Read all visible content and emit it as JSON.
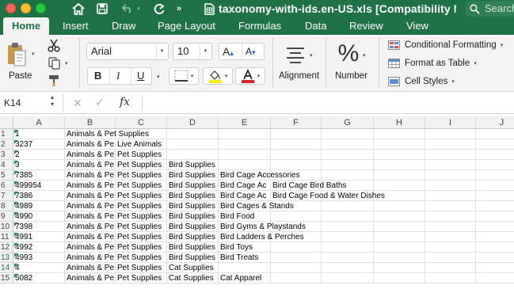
{
  "window": {
    "title": "taxonomy-with-ids.en-US.xls  [Compatibility Mode]",
    "search_placeholder": "Search"
  },
  "tabs": [
    "Home",
    "Insert",
    "Draw",
    "Page Layout",
    "Formulas",
    "Data",
    "Review",
    "View"
  ],
  "ribbon": {
    "paste_label": "Paste",
    "font_name": "Arial",
    "font_size": "10",
    "bold": "B",
    "italic": "I",
    "underline": "U",
    "alignment_label": "Alignment",
    "number_label": "Number",
    "conditional_formatting": "Conditional Formatting",
    "format_as_table": "Format as Table",
    "cell_styles": "Cell Styles",
    "highlight_color": "#ffee00",
    "font_color": "#e02020"
  },
  "formula_bar": {
    "name_box": "K14",
    "fx_label": "fx",
    "formula": ""
  },
  "sheet": {
    "columns": [
      "A",
      "B",
      "C",
      "D",
      "E",
      "F",
      "G",
      "H",
      "I",
      "J"
    ],
    "highlighted_rows": [
      "13",
      "14"
    ],
    "rows": [
      {
        "num": "1",
        "cells": [
          "1",
          "Animals & Pet Supplies",
          "",
          "",
          "",
          ""
        ]
      },
      {
        "num": "2",
        "cells": [
          "3237",
          "Animals & Pe",
          "Live Animals",
          "",
          "",
          ""
        ]
      },
      {
        "num": "3",
        "cells": [
          "2",
          "Animals & Pe",
          "Pet Supplies",
          "",
          "",
          ""
        ]
      },
      {
        "num": "4",
        "cells": [
          "3",
          "Animals & Pe",
          "Pet Supplies",
          "Bird Supplies",
          "",
          ""
        ]
      },
      {
        "num": "5",
        "cells": [
          "7385",
          "Animals & Pe",
          "Pet Supplies",
          "Bird Supplies",
          "Bird Cage Accessories",
          ""
        ]
      },
      {
        "num": "6",
        "cells": [
          "499954",
          "Animals & Pe",
          "Pet Supplies",
          "Bird Supplies",
          "Bird Cage Ac",
          "Bird Cage Bird Baths"
        ]
      },
      {
        "num": "7",
        "cells": [
          "7386",
          "Animals & Pe",
          "Pet Supplies",
          "Bird Supplies",
          "Bird Cage Ac",
          "Bird Cage Food & Water Dishes"
        ]
      },
      {
        "num": "8",
        "cells": [
          "4989",
          "Animals & Pe",
          "Pet Supplies",
          "Bird Supplies",
          "Bird Cages & Stands",
          ""
        ]
      },
      {
        "num": "9",
        "cells": [
          "4990",
          "Animals & Pe",
          "Pet Supplies",
          "Bird Supplies",
          "Bird Food",
          ""
        ]
      },
      {
        "num": "10",
        "cells": [
          "7398",
          "Animals & Pe",
          "Pet Supplies",
          "Bird Supplies",
          "Bird Gyms & Playstands",
          ""
        ]
      },
      {
        "num": "11",
        "cells": [
          "4991",
          "Animals & Pe",
          "Pet Supplies",
          "Bird Supplies",
          "Bird Ladders & Perches",
          ""
        ]
      },
      {
        "num": "12",
        "cells": [
          "4992",
          "Animals & Pe",
          "Pet Supplies",
          "Bird Supplies",
          "Bird Toys",
          ""
        ]
      },
      {
        "num": "13",
        "cells": [
          "4993",
          "Animals & Pe",
          "Pet Supplies",
          "Bird Supplies",
          "Bird Treats",
          ""
        ]
      },
      {
        "num": "14",
        "cells": [
          "4",
          "Animals & Pe",
          "Pet Supplies",
          "Cat Supplies",
          "",
          ""
        ]
      },
      {
        "num": "15",
        "cells": [
          "5082",
          "Animals & Pe",
          "Pet Supplies",
          "Cat Supplies",
          "Cat Apparel",
          ""
        ]
      }
    ]
  }
}
